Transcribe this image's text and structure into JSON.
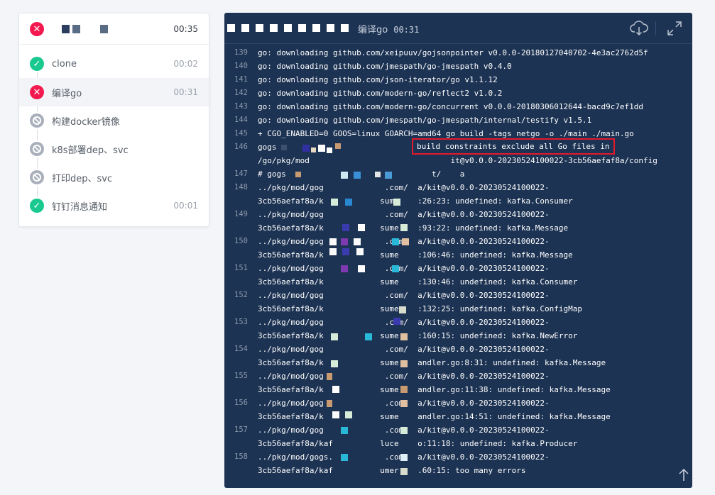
{
  "pipeline": {
    "header": {
      "time": "00:35",
      "status": "failed"
    },
    "steps": [
      {
        "name": "clone",
        "time": "00:02",
        "status": "success"
      },
      {
        "name": "编译go",
        "time": "00:31",
        "status": "failed"
      },
      {
        "name": "构建docker镜像",
        "time": "",
        "status": "skipped"
      },
      {
        "name": "k8s部署dep、svc",
        "time": "",
        "status": "skipped"
      },
      {
        "name": "打印dep、svc",
        "time": "",
        "status": "skipped"
      },
      {
        "name": "钉钉消息通知",
        "time": "00:01",
        "status": "success"
      }
    ]
  },
  "log": {
    "title": "编译go",
    "time": "00:31",
    "icons": {
      "download": "cloud-download-icon",
      "fullscreen": "expand-icon",
      "top": "arrow-up-icon"
    },
    "lines": [
      {
        "no": "139",
        "text": "go: downloading github.com/xeipuuv/gojsonpointer v0.0.0-20180127040702-4e3ac2762d5f"
      },
      {
        "no": "140",
        "text": "go: downloading github.com/jmespath/go-jmespath v0.4.0"
      },
      {
        "no": "141",
        "text": "go: downloading github.com/json-iterator/go v1.1.12"
      },
      {
        "no": "142",
        "text": "go: downloading github.com/modern-go/reflect2 v1.0.2"
      },
      {
        "no": "143",
        "text": "go: downloading github.com/modern-go/concurrent v0.0.0-20180306012644-bacd9c7ef1dd"
      },
      {
        "no": "144",
        "text": "go: downloading github.com/jmespath/go-jmespath/internal/testify v1.5.1"
      },
      {
        "no": "145",
        "text": "+ CGO_ENABLED=0 GOOS=linux GOARCH=amd64 go build -tags netgo -o ./main ./main.go"
      },
      {
        "no": "146",
        "text": "gogs",
        "highlight": "build constraints exclude all Go files in"
      },
      {
        "no": "",
        "text": "/go/pkg/mod                              it@v0.0.0-20230524100022-3cb56aefaf8a/config"
      },
      {
        "no": "147",
        "text": "# gogs                               t/    a"
      },
      {
        "no": "148",
        "text": "../pkg/mod/gog             .com/  a/kit@v0.0.0-20230524100022-"
      },
      {
        "no": "",
        "text": "3cb56aefaf8a/k            sume    :26:23: undefined: kafka.Consumer"
      },
      {
        "no": "149",
        "text": "../pkg/mod/gog             .com/  a/kit@v0.0.0-20230524100022-"
      },
      {
        "no": "",
        "text": "3cb56aefaf8a/k            sume    :93:22: undefined: kafka.Message"
      },
      {
        "no": "150",
        "text": "../pkg/mod/gog             .com/  a/kit@v0.0.0-20230524100022-"
      },
      {
        "no": "",
        "text": "3cb56aefaf8a/k            sume    :106:46: undefined: kafka.Message"
      },
      {
        "no": "151",
        "text": "../pkg/mod/gog             .com/  a/kit@v0.0.0-20230524100022-"
      },
      {
        "no": "",
        "text": "3cb56aefaf8a/k            sume    :130:46: undefined: kafka.Consumer"
      },
      {
        "no": "152",
        "text": "../pkg/mod/gog             .com/  a/kit@v0.0.0-20230524100022-"
      },
      {
        "no": "",
        "text": "3cb56aefaf8a/k            sume    :132:25: undefined: kafka.ConfigMap"
      },
      {
        "no": "153",
        "text": "../pkg/mod/gog             .com/  a/kit@v0.0.0-20230524100022-"
      },
      {
        "no": "",
        "text": "3cb56aefaf8a/k            sume    :160:15: undefined: kafka.NewError"
      },
      {
        "no": "154",
        "text": "../pkg/mod/gog             .com/  a/kit@v0.0.0-20230524100022-"
      },
      {
        "no": "",
        "text": "3cb56aefaf8a/k            sume    andler.go:8:31: undefined: kafka.Message"
      },
      {
        "no": "155",
        "text": "../pkg/mod/gog             .com/  a/kit@v0.0.0-20230524100022-"
      },
      {
        "no": "",
        "text": "3cb56aefaf8a/k            sume    andler.go:11:38: undefined: kafka.Message"
      },
      {
        "no": "156",
        "text": "../pkg/mod/gog             .com/  a/kit@v0.0.0-20230524100022-"
      },
      {
        "no": "",
        "text": "3cb56aefaf8a/k            sume    andler.go:14:51: undefined: kafka.Message"
      },
      {
        "no": "157",
        "text": "../pkg/mod/gog             .com/  a/kit@v0.0.0-20230524100022-"
      },
      {
        "no": "",
        "text": "3cb56aefaf8a/kaf          luce    o:11:18: undefined: kafka.Producer"
      },
      {
        "no": "158",
        "text": "../pkg/mod/gogs.           .com/  a/kit@v0.0.0-20230524100022-"
      },
      {
        "no": "",
        "text": "3cb56aefaf8a/kaf          umer    .60:15: too many errors"
      }
    ]
  },
  "colors": {
    "failed": "#f3184e",
    "success": "#1ac98f",
    "skipped": "#a9b0bb",
    "log_bg": "#1d3353",
    "highlight_border": "#e5192b"
  }
}
